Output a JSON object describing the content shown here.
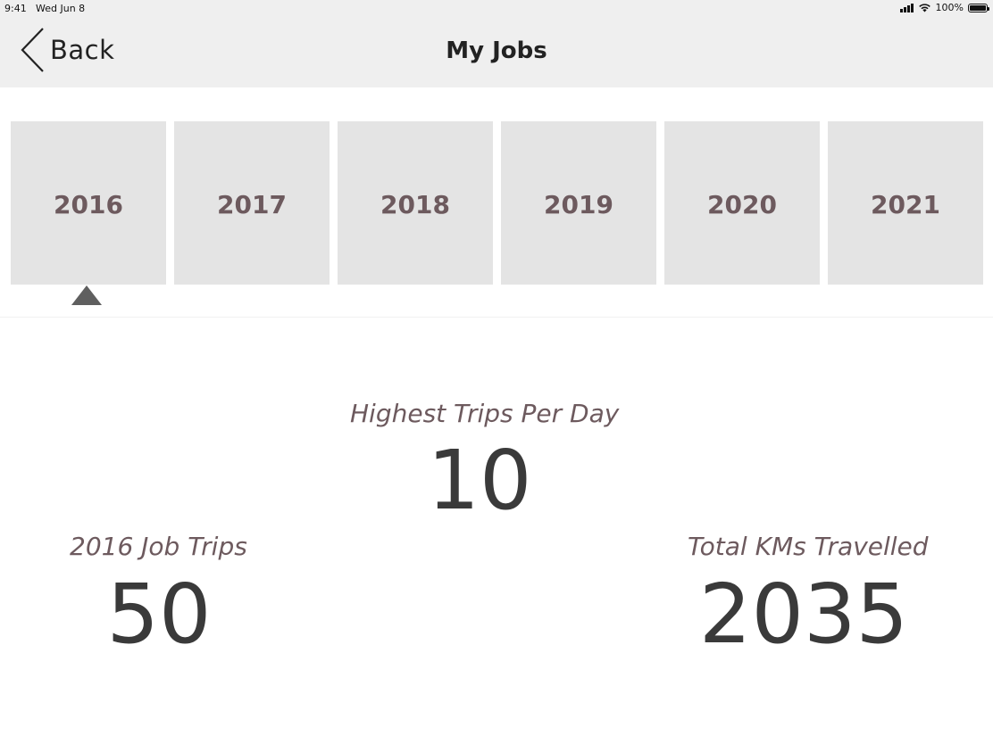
{
  "status_bar": {
    "time": "9:41",
    "date": "Wed Jun 8",
    "battery": "100%"
  },
  "nav": {
    "back_label": "Back",
    "title": "My Jobs"
  },
  "years": [
    "2016",
    "2017",
    "2018",
    "2019",
    "2020",
    "2021"
  ],
  "selected_year": "2016",
  "stats": {
    "highest_trips_label": "Highest Trips Per Day",
    "highest_trips_value": "10",
    "job_trips_label": "2016 Job Trips",
    "job_trips_value": "50",
    "total_kms_label": "Total KMs Travelled",
    "total_kms_value": "2035"
  },
  "colors": {
    "header_bg": "#efefef",
    "tab_bg": "#e4e4e4",
    "label_color": "#6d5a5e",
    "value_color": "#3a3a3a",
    "indicator": "#5f5f5f"
  }
}
